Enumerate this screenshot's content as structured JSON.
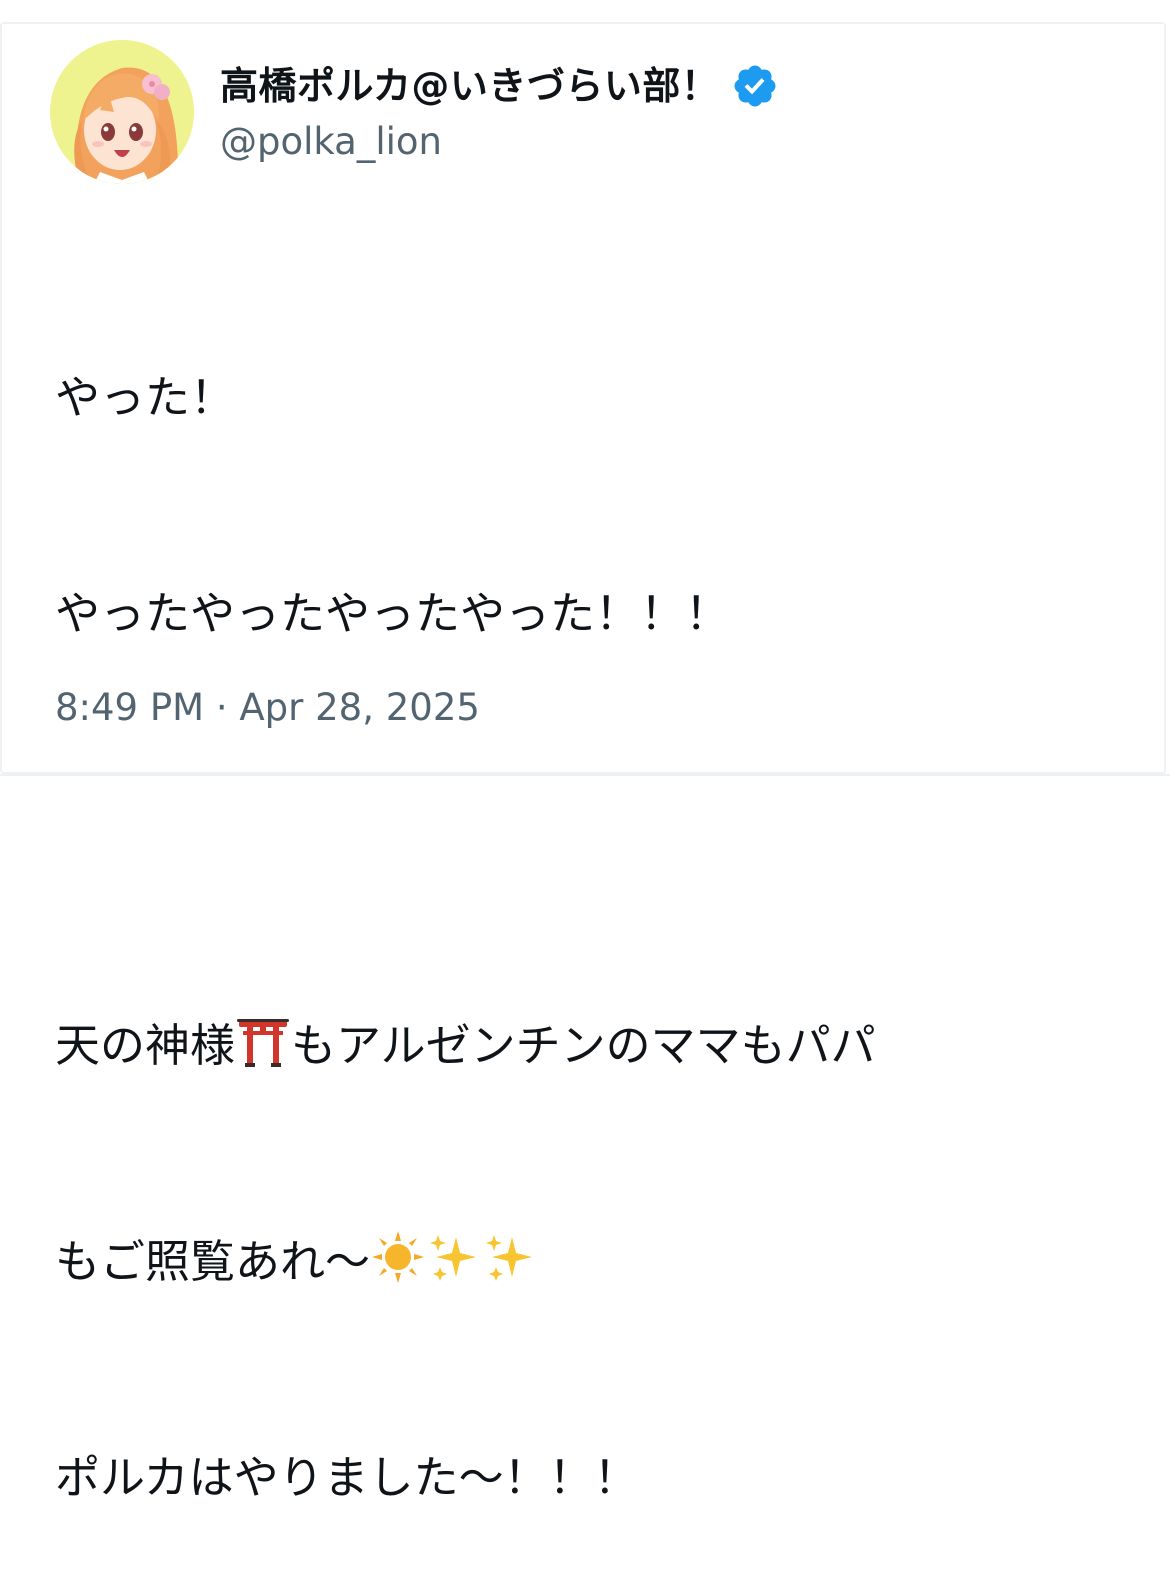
{
  "tweet": {
    "author": {
      "display_name": "高橋ポルカ@いきづらい部！",
      "handle": "@polka_lion",
      "verified": true,
      "avatar_icon": "anime-girl-avatar"
    },
    "lines": {
      "l1": "やった！",
      "l2": "やったやったやったやった！！！",
      "l4a": "天の神様",
      "l4b": "もアルゼンチンのママもパパ",
      "l5": "もご照覧あれ〜",
      "l6": "ポルカはやりました〜！！！"
    },
    "emojis": {
      "shrine": "torii-gate-emoji",
      "sun": "sun-emoji",
      "sparkles": "sparkles-emoji"
    },
    "timestamp": "8:49 PM · Apr 28, 2025"
  },
  "colors": {
    "text_primary": "#0f1419",
    "text_secondary": "#536471",
    "verified_blue": "#1d9bf0",
    "border": "#eef1f4",
    "avatar_bg": "#eef38f"
  }
}
